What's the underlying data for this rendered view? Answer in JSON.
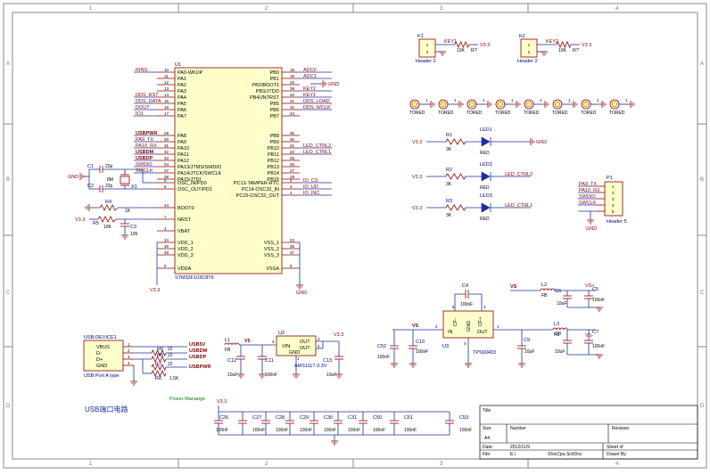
{
  "grid": {
    "cols": [
      "1",
      "2",
      "3",
      "4"
    ],
    "rows": [
      "A",
      "B",
      "C",
      "D"
    ]
  },
  "mcu": {
    "designator": "U1",
    "part": "STM32F103C8T6",
    "left_pins": [
      {
        "num": "10",
        "name": "PA0-WKUP",
        "net": "RING"
      },
      {
        "num": "11",
        "name": "PA1",
        "net": ""
      },
      {
        "num": "12",
        "name": "PA2",
        "net": ""
      },
      {
        "num": "13",
        "name": "PA3",
        "net": ""
      },
      {
        "num": "14",
        "name": "PA4",
        "net": "DDS_RST"
      },
      {
        "num": "15",
        "name": "PA5",
        "net": "DDS_DATA"
      },
      {
        "num": "16",
        "name": "PA6",
        "net": "DOUT"
      },
      {
        "num": "17",
        "name": "PA7",
        "net": "IO1"
      },
      {
        "num": "29",
        "name": "PA8",
        "net": "USBPWR"
      },
      {
        "num": "30",
        "name": "PA9",
        "net": "PA9_TX"
      },
      {
        "num": "31",
        "name": "PA10",
        "net": "PA10_RX"
      },
      {
        "num": "32",
        "name": "PA11",
        "net": "USBDM"
      },
      {
        "num": "33",
        "name": "PA12",
        "net": "USBDP"
      },
      {
        "num": "34",
        "name": "PA13/JTMS/SWDIO",
        "net": "SWDIO"
      },
      {
        "num": "37",
        "name": "PA14/JTCK/SWCLK",
        "net": "SWCLK"
      },
      {
        "num": "38",
        "name": "PA15/JTDI",
        "net": ""
      }
    ],
    "right_pins": [
      {
        "num": "18",
        "name": "PB0",
        "net": "ADC0"
      },
      {
        "num": "19",
        "name": "PB1",
        "net": "ADC1"
      },
      {
        "num": "20",
        "name": "PB2/BOOT1",
        "net": ""
      },
      {
        "num": "39",
        "name": "PB3/JTDO",
        "net": "KEY2"
      },
      {
        "num": "40",
        "name": "PB4/JNTRST",
        "net": "KEY1"
      },
      {
        "num": "41",
        "name": "PB5",
        "net": "DDS_LOAD"
      },
      {
        "num": "42",
        "name": "PB6",
        "net": "DDS_WCLK"
      },
      {
        "num": "43",
        "name": "PB7",
        "net": ""
      },
      {
        "num": "45",
        "name": "PB8",
        "net": ""
      },
      {
        "num": "46",
        "name": "PB9",
        "net": ""
      },
      {
        "num": "21",
        "name": "PB10",
        "net": "LED_CTRL2"
      },
      {
        "num": "22",
        "name": "PB11",
        "net": "LED_CTRL1"
      },
      {
        "num": "25",
        "name": "PB12",
        "net": ""
      },
      {
        "num": "26",
        "name": "PB13",
        "net": ""
      },
      {
        "num": "27",
        "name": "PB14",
        "net": ""
      },
      {
        "num": "28",
        "name": "PB15",
        "net": ""
      }
    ],
    "osc_pins": [
      {
        "num": "5",
        "name": "OSC_IN/PD0"
      },
      {
        "num": "6",
        "name": "OSC_OUT/PD1"
      }
    ],
    "rtc_pins": [
      {
        "num": "2",
        "name": "PC13-TAMPER-RTC",
        "net": "IO_CS"
      },
      {
        "num": "3",
        "name": "PC14-OSC32_IN",
        "net": "IO_UD"
      },
      {
        "num": "4",
        "name": "PC15-OSC32_OUT",
        "net": "IO_INC"
      }
    ],
    "boot": {
      "num": "44",
      "name": "BOOT0"
    },
    "nrst": {
      "num": "7",
      "name": "NRST"
    },
    "vbat": {
      "num": "1",
      "name": "VBAT"
    },
    "vdd_pins": [
      {
        "num": "24",
        "name": "VDD_1"
      },
      {
        "num": "36",
        "name": "VDD_2"
      },
      {
        "num": "48",
        "name": "VDD_3"
      }
    ],
    "vdda": {
      "num": "9",
      "name": "VDDA"
    },
    "vss_pins": [
      {
        "num": "23",
        "name": "VSS_1"
      },
      {
        "num": "35",
        "name": "VSS_2"
      },
      {
        "num": "47",
        "name": "VSS_3"
      }
    ],
    "vssa": {
      "num": "8",
      "name": "VSSA"
    }
  },
  "labels": {
    "gnd": "GND",
    "v33": "V3.3",
    "v5": "V5",
    "usb5v": "USB5V",
    "usbdm": "USBDM",
    "usbdp": "USBDP",
    "usbpwr": "USBPWR",
    "led_ctrl2": "LED_CTRL2",
    "led_ctrl1": "LED_CTRL1",
    "vs": "VS",
    "vsn": "VS-",
    "vsp": "VS+"
  },
  "crystal": {
    "c1": "C1",
    "c1v": "22p",
    "c2": "C2",
    "c2v": "22p",
    "x": "X1",
    "xv": "8M"
  },
  "reset": {
    "r4": "R4",
    "r4v": "1K",
    "r5": "R5",
    "r5v": "10K",
    "c3": "C3",
    "c3v": "105"
  },
  "keys": [
    {
      "des": "K1",
      "pin1": "1",
      "pin2": "2",
      "type": "Header 2",
      "net": "KEY1",
      "r": "R?",
      "rv": "10K",
      "v": "V3.3"
    },
    {
      "des": "K2",
      "pin1": "1",
      "pin2": "2",
      "type": "Header 2",
      "net": "KEY2",
      "r": "R?",
      "rv": "10K",
      "v": "V3.3"
    }
  ],
  "holes": [
    "TORED",
    "TORED",
    "TORED",
    "TORED",
    "TORED",
    "TORED",
    "TORED",
    "TORED"
  ],
  "hole_pin": "1",
  "leds": [
    {
      "r": "R1",
      "rv": "3K",
      "led": "LED1",
      "color": "RED",
      "left": "V3.3",
      "right": "GND"
    },
    {
      "r": "R2",
      "rv": "3K",
      "led": "LED2",
      "color": "RED",
      "left": "V3.3",
      "right": "LED_CTRL2"
    },
    {
      "r": "R3",
      "rv": "3K",
      "led": "LED3",
      "color": "RED",
      "left": "V3.3",
      "right": "LED_CTRL1"
    }
  ],
  "header5": {
    "des": "P1",
    "type": "Header 5",
    "pins": [
      "1",
      "2",
      "3",
      "4",
      "5"
    ],
    "nets": [
      "PA9_TX",
      "PA10_RX",
      "SWDIO",
      "SWCLK",
      "GND"
    ]
  },
  "usb": {
    "des": "USB-DEVICE1",
    "type": "USB Port A type",
    "pins": [
      "VBUS",
      "D-",
      "D+",
      "GND"
    ],
    "nums": [
      "1",
      "2",
      "3",
      "4"
    ],
    "r6": "R6",
    "r6v": "22",
    "r9": "R9",
    "r9v": "22",
    "r7": "R7",
    "r7v": "22",
    "r8": "R8",
    "r8v": "1.5K"
  },
  "power": {
    "title": "Power Manange",
    "l1": "L1",
    "l1v": "FB",
    "c12": "C12",
    "c12v": "10uF",
    "c11": "C11",
    "c11v": "100nF",
    "u2": "U2",
    "u2v": "AMS1117-3.3V",
    "c13": "C13",
    "c13v": "10uF",
    "vin": "VIN",
    "out1": "OUT",
    "out2": "OUT",
    "gndpin": "GND",
    "pin3": "3",
    "pin2": "2",
    "pin4": "4",
    "pin1": "1"
  },
  "tps": {
    "u3": "U3",
    "part": "TPS60403",
    "c4": "C4",
    "c4v": "100nF",
    "c52": "C52",
    "c52v": "100nF",
    "c10": "C10",
    "c10v": "100nF",
    "c9": "C9",
    "c9v": "10uF",
    "in": "IN",
    "out": "OUT",
    "cfm": "CF-",
    "cfp": "CF+",
    "gnd": "GND",
    "p1": "1",
    "p2": "2",
    "p3": "3",
    "p4": "4",
    "p5": "5"
  },
  "filters": {
    "l2": "L2",
    "l2v": "FB",
    "c6": "C6",
    "c6v": "10uF",
    "c5": "C5",
    "c5v": "100nF",
    "l3": "L3",
    "l3v": "FB",
    "c8": "C8",
    "c8v": "10uF",
    "c7": "C7",
    "c7v": "100nF"
  },
  "decoupling": [
    {
      "des": "C26",
      "val": "100nF"
    },
    {
      "des": "C27",
      "val": "100nF"
    },
    {
      "des": "C28",
      "val": "100nF"
    },
    {
      "des": "C29",
      "val": "100nF"
    },
    {
      "des": "C30",
      "val": "100nF"
    },
    {
      "des": "C31",
      "val": "100nF"
    },
    {
      "des": "C50",
      "val": "100nF"
    },
    {
      "des": "C51",
      "val": "100nF"
    },
    {
      "des": "C53",
      "val": "100nF"
    }
  ],
  "section_title": "USB端口电路",
  "titleblock": {
    "title": "Title",
    "size": "Size",
    "size_val": "A4",
    "number": "Number",
    "revision": "Revision",
    "date": "Date:",
    "date_val": "2012/11/9",
    "file": "File:",
    "file_val": "E:\\",
    "file_path": "\\DocCpu.SchDoc",
    "sheet": "Sheet   of",
    "drawn": "Drawn By:"
  }
}
